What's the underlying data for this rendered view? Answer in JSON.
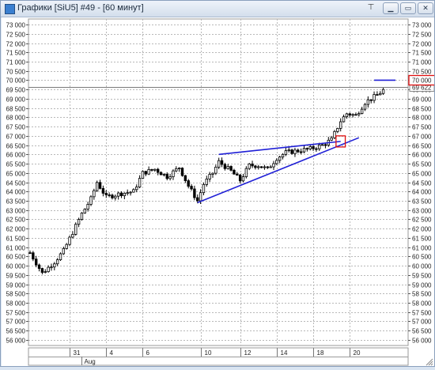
{
  "window": {
    "title": "Графики [SiU5] #49 - [60 минут]",
    "pin_icon": "pin-icon",
    "buttons": [
      {
        "name": "minimize-button",
        "glyph": "▁"
      },
      {
        "name": "maximize-button",
        "glyph": "▭"
      },
      {
        "name": "close-button",
        "glyph": "✕"
      }
    ]
  },
  "chart_data": {
    "type": "candlestick",
    "ylim": [
      55700,
      73300
    ],
    "y_ticks": [
      56000,
      56500,
      57000,
      57500,
      58000,
      58500,
      59000,
      59500,
      60000,
      60500,
      61000,
      61500,
      62000,
      62500,
      63000,
      63500,
      64000,
      64500,
      65000,
      65500,
      66000,
      66500,
      67000,
      67500,
      68000,
      68500,
      69000,
      69500,
      70000,
      70500,
      71000,
      71500,
      72000,
      72500,
      73000
    ],
    "y_tick_labels": [
      "56 000",
      "56 500",
      "57 000",
      "57 500",
      "58 000",
      "58 500",
      "59 000",
      "59 500",
      "60 000",
      "60 500",
      "61 000",
      "61 500",
      "62 000",
      "62 500",
      "63 000",
      "63 500",
      "64 000",
      "64 500",
      "65 000",
      "65 500",
      "66 000",
      "66 500",
      "67 000",
      "67 500",
      "68 000",
      "68 500",
      "69 000",
      "69 500",
      "70 000",
      "70 500",
      "71 000",
      "71 500",
      "72 000",
      "72 500",
      "73 000"
    ],
    "x_ticks": [
      "31",
      "4",
      "6",
      "10",
      "12",
      "14",
      "18",
      "20"
    ],
    "x_tick_bar_index": [
      13,
      25,
      37,
      56,
      69,
      81,
      93,
      105
    ],
    "month_label": "Aug",
    "month_start_bar_index": 17,
    "bar_count": 123,
    "price_path": [
      {
        "bar": 0,
        "price": 60700
      },
      {
        "bar": 4,
        "price": 59600
      },
      {
        "bar": 8,
        "price": 60200
      },
      {
        "bar": 11,
        "price": 60800
      },
      {
        "bar": 14,
        "price": 61800
      },
      {
        "bar": 17,
        "price": 62800
      },
      {
        "bar": 20,
        "price": 63600
      },
      {
        "bar": 22,
        "price": 64500
      },
      {
        "bar": 25,
        "price": 63700
      },
      {
        "bar": 30,
        "price": 63900
      },
      {
        "bar": 34,
        "price": 64000
      },
      {
        "bar": 37,
        "price": 65000
      },
      {
        "bar": 41,
        "price": 65200
      },
      {
        "bar": 45,
        "price": 64800
      },
      {
        "bar": 49,
        "price": 65300
      },
      {
        "bar": 52,
        "price": 64300
      },
      {
        "bar": 55,
        "price": 63500
      },
      {
        "bar": 57,
        "price": 64400
      },
      {
        "bar": 60,
        "price": 65000
      },
      {
        "bar": 62,
        "price": 65600
      },
      {
        "bar": 66,
        "price": 65100
      },
      {
        "bar": 69,
        "price": 64600
      },
      {
        "bar": 72,
        "price": 65400
      },
      {
        "bar": 75,
        "price": 65400
      },
      {
        "bar": 78,
        "price": 65200
      },
      {
        "bar": 81,
        "price": 65800
      },
      {
        "bar": 84,
        "price": 66100
      },
      {
        "bar": 88,
        "price": 66200
      },
      {
        "bar": 92,
        "price": 66300
      },
      {
        "bar": 96,
        "price": 66500
      },
      {
        "bar": 99,
        "price": 66800
      },
      {
        "bar": 102,
        "price": 67800
      },
      {
        "bar": 104,
        "price": 68200
      },
      {
        "bar": 107,
        "price": 68100
      },
      {
        "bar": 110,
        "price": 68800
      },
      {
        "bar": 114,
        "price": 69200
      },
      {
        "bar": 117,
        "price": 69600
      }
    ],
    "trendlines": [
      {
        "name": "triangle-upper-line",
        "from": {
          "bar": 62,
          "price": 66000
        },
        "to": {
          "bar": 102,
          "price": 66700
        }
      },
      {
        "name": "triangle-lower-line",
        "from": {
          "bar": 55,
          "price": 63400
        },
        "to": {
          "bar": 108,
          "price": 66900
        }
      },
      {
        "name": "level-70000-line",
        "from": {
          "bar": 113,
          "price": 70000
        },
        "to": {
          "bar": 120,
          "price": 70000
        }
      }
    ],
    "highlight_box": {
      "from_bar": 101,
      "to_bar": 103,
      "low": 66400,
      "high": 67000
    },
    "last_price": 69622,
    "last_price_label": "69 622",
    "boxed_level_label": "70 000",
    "grid": true,
    "colors": {
      "candles": "#000000",
      "trendline": "#1f1fd6",
      "highlight": "#e01010",
      "grid": "#b8b8b8",
      "last_price_line": "#7a7a7a"
    }
  }
}
